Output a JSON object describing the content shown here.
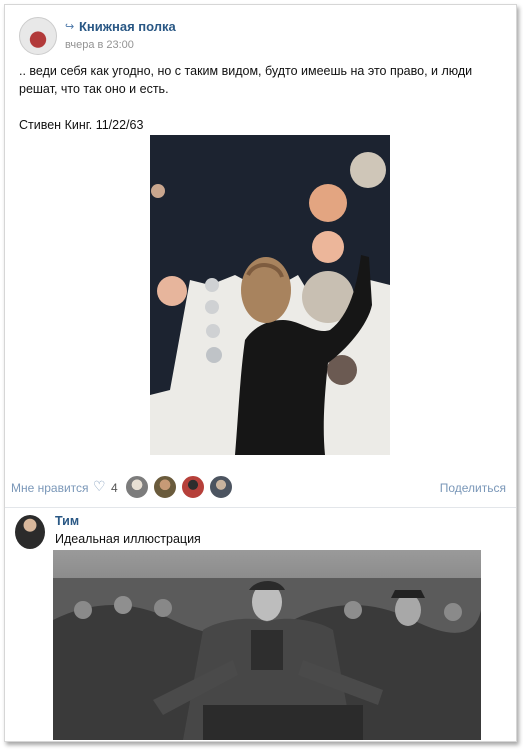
{
  "post": {
    "group_name": "Книжная полка",
    "time": "вчера в 23:00",
    "text_line1": ".. веди себя как угодно, но с таким видом, будто имеешь на это право, и люди",
    "text_line2": "решат, что так оно и есть.",
    "text_line3": "Стивен Кинг. 11/22/63",
    "like_label": "Мне нравится",
    "like_count": "4",
    "share_label": "Поделиться"
  },
  "comment": {
    "author": "Тим",
    "text": "Идеальная иллюстрация"
  },
  "colors": {
    "link": "#2a5885",
    "muted_link": "#7a97b8",
    "time": "#939393"
  },
  "icons": {
    "repost": "repost-icon",
    "like": "heart-icon"
  }
}
